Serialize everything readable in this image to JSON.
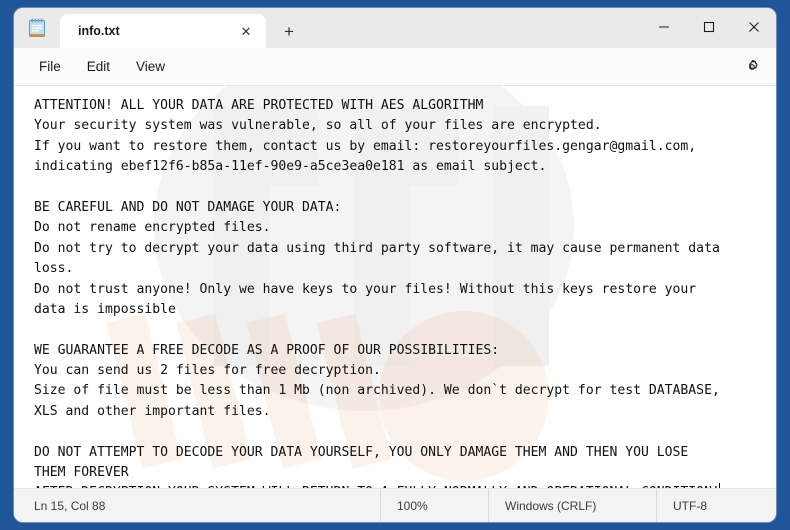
{
  "desktop": {
    "background_color": "#1f5599"
  },
  "window": {
    "app_icon": "notepad-icon",
    "tab": {
      "title": "info.txt",
      "close_label": "✕"
    },
    "new_tab_label": "+",
    "controls": {
      "minimize": "─",
      "maximize": "□",
      "close": "✕"
    }
  },
  "menubar": {
    "items": [
      {
        "label": "File"
      },
      {
        "label": "Edit"
      },
      {
        "label": "View"
      }
    ],
    "settings_icon": "gear-icon"
  },
  "editor": {
    "lines": [
      "ATTENTION! ALL YOUR DATA ARE PROTECTED WITH AES ALGORITHM",
      "Your security system was vulnerable, so all of your files are encrypted.",
      "If you want to restore them, contact us by email: restoreyourfiles.gengar@gmail.com,",
      "indicating ebef12f6-b85a-11ef-90e9-a5ce3ea0e181 as email subject.",
      "",
      "BE CAREFUL AND DO NOT DAMAGE YOUR DATA:",
      "Do not rename encrypted files.",
      "Do not try to decrypt your data using third party software, it may cause permanent data",
      "loss.",
      "Do not trust anyone! Only we have keys to your files! Without this keys restore your",
      "data is impossible",
      "",
      "WE GUARANTEE A FREE DECODE AS A PROOF OF OUR POSSIBILITIES:",
      "You can send us 2 files for free decryption.",
      "Size of file must be less than 1 Mb (non archived). We don`t decrypt for test DATABASE,",
      "XLS and other important files.",
      "",
      "DO NOT ATTEMPT TO DECODE YOUR DATA YOURSELF, YOU ONLY DAMAGE THEM AND THEN YOU LOSE",
      "THEM FOREVER",
      "AFTER DECRYPTION YOUR SYSTEM WILL RETURN TO A FULLY NORMALLY AND OPERATIONAL CONDITION!"
    ],
    "email": "restoreyourfiles.gengar@gmail.com",
    "victim_id": "ebef12f6-b85a-11ef-90e9-a5ce3ea0e181",
    "caret_line_index": 19
  },
  "statusbar": {
    "position": "Ln 15, Col 88",
    "zoom": "100%",
    "line_endings": "Windows (CRLF)",
    "encoding": "UTF-8"
  }
}
